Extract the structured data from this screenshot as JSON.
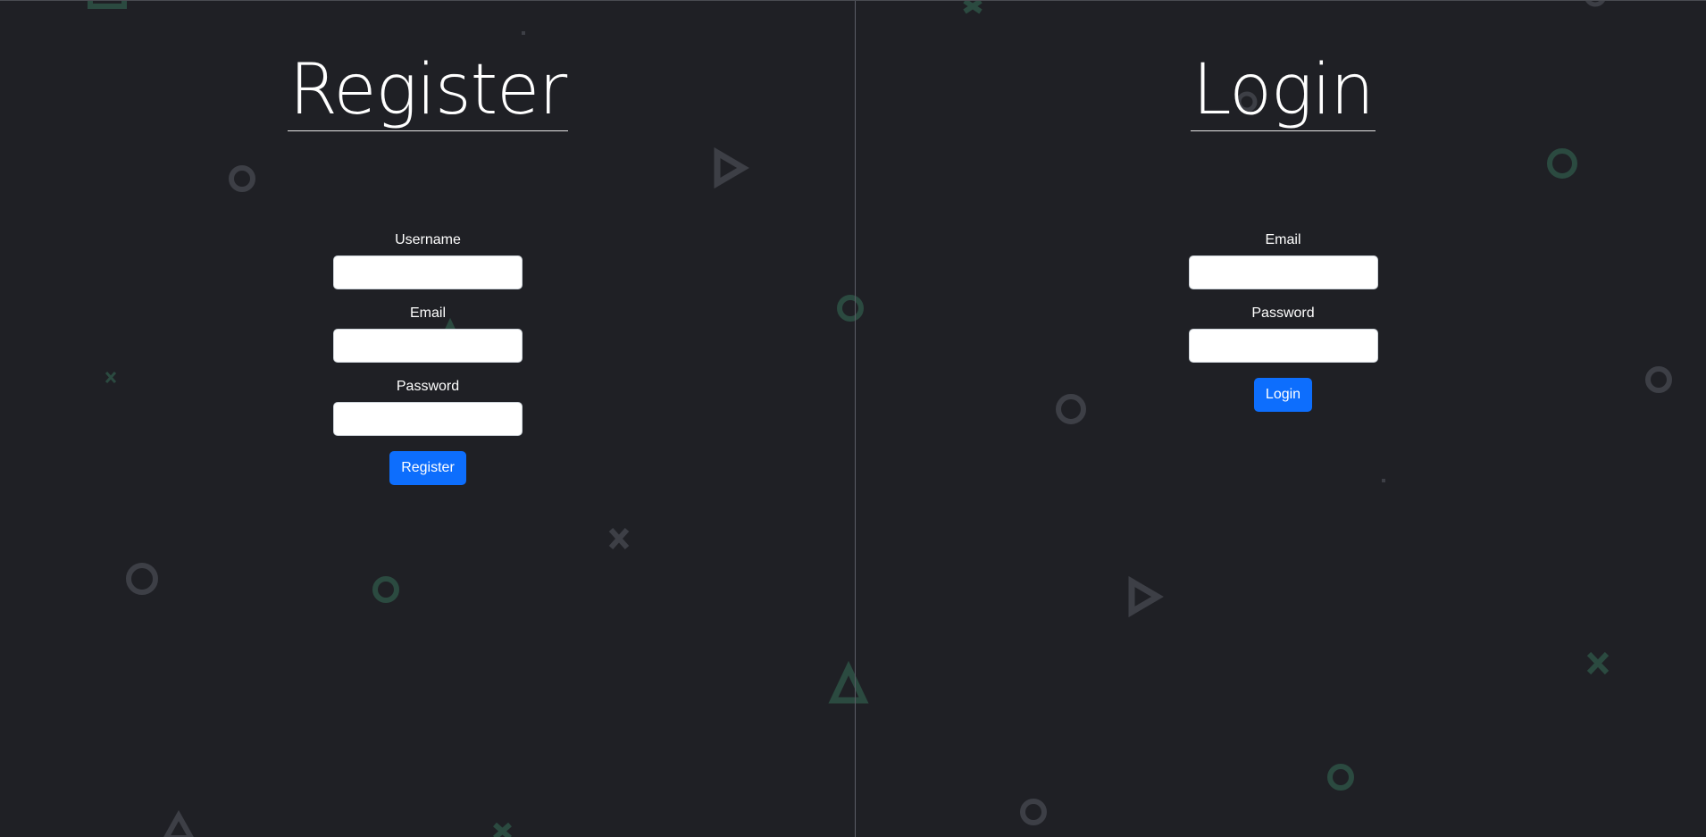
{
  "register": {
    "title": "Register",
    "fields": [
      {
        "label": "Username",
        "value": ""
      },
      {
        "label": "Email",
        "value": ""
      },
      {
        "label": "Password",
        "value": ""
      }
    ],
    "button_label": "Register"
  },
  "login": {
    "title": "Login",
    "fields": [
      {
        "label": "Email",
        "value": ""
      },
      {
        "label": "Password",
        "value": ""
      }
    ],
    "button_label": "Login"
  },
  "theme": {
    "background": "#1f2025",
    "accent": "#0d6efd",
    "decor_gray": "#3d3f46",
    "decor_green": "#2b4a40"
  },
  "background_icons": [
    "circle-icon",
    "triangle-icon",
    "cross-icon",
    "plus-circle-icon",
    "play-icon"
  ]
}
